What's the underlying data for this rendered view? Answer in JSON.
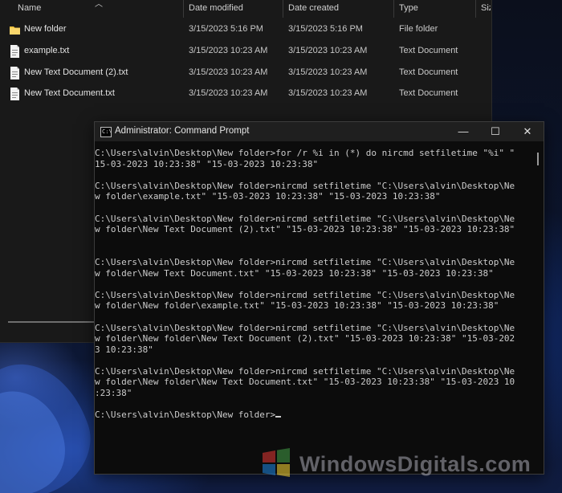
{
  "explorer": {
    "columns": {
      "name": "Name",
      "date_modified": "Date modified",
      "date_created": "Date created",
      "type": "Type",
      "size": "Size"
    },
    "files": [
      {
        "name": "New folder",
        "modified": "3/15/2023 5:16 PM",
        "created": "3/15/2023 5:16 PM",
        "type": "File folder",
        "icon": "folder-icon"
      },
      {
        "name": "example.txt",
        "modified": "3/15/2023 10:23 AM",
        "created": "3/15/2023 10:23 AM",
        "type": "Text Document",
        "icon": "text-file-icon"
      },
      {
        "name": "New Text Document (2).txt",
        "modified": "3/15/2023 10:23 AM",
        "created": "3/15/2023 10:23 AM",
        "type": "Text Document",
        "icon": "text-file-icon"
      },
      {
        "name": "New Text Document.txt",
        "modified": "3/15/2023 10:23 AM",
        "created": "3/15/2023 10:23 AM",
        "type": "Text Document",
        "icon": "text-file-icon"
      }
    ]
  },
  "cmd": {
    "title": "Administrator: Command Prompt",
    "app_icon_text": "C:\\",
    "controls": {
      "minimize": "—",
      "maximize": "☐",
      "close": "✕"
    },
    "lines": [
      "C:\\Users\\alvin\\Desktop\\New folder>for /r %i in (*) do nircmd setfiletime \"%i\" \"",
      "15-03-2023 10:23:38\" \"15-03-2023 10:23:38\"",
      "",
      "C:\\Users\\alvin\\Desktop\\New folder>nircmd setfiletime \"C:\\Users\\alvin\\Desktop\\Ne",
      "w folder\\example.txt\" \"15-03-2023 10:23:38\" \"15-03-2023 10:23:38\"",
      "",
      "C:\\Users\\alvin\\Desktop\\New folder>nircmd setfiletime \"C:\\Users\\alvin\\Desktop\\Ne",
      "w folder\\New Text Document (2).txt\" \"15-03-2023 10:23:38\" \"15-03-2023 10:23:38\"",
      "",
      "",
      "C:\\Users\\alvin\\Desktop\\New folder>nircmd setfiletime \"C:\\Users\\alvin\\Desktop\\Ne",
      "w folder\\New Text Document.txt\" \"15-03-2023 10:23:38\" \"15-03-2023 10:23:38\"",
      "",
      "C:\\Users\\alvin\\Desktop\\New folder>nircmd setfiletime \"C:\\Users\\alvin\\Desktop\\Ne",
      "w folder\\New folder\\example.txt\" \"15-03-2023 10:23:38\" \"15-03-2023 10:23:38\"",
      "",
      "C:\\Users\\alvin\\Desktop\\New folder>nircmd setfiletime \"C:\\Users\\alvin\\Desktop\\Ne",
      "w folder\\New folder\\New Text Document (2).txt\" \"15-03-2023 10:23:38\" \"15-03-202",
      "3 10:23:38\"",
      "",
      "C:\\Users\\alvin\\Desktop\\New folder>nircmd setfiletime \"C:\\Users\\alvin\\Desktop\\Ne",
      "w folder\\New folder\\New Text Document.txt\" \"15-03-2023 10:23:38\" \"15-03-2023 10",
      ":23:38\"",
      ""
    ],
    "prompt": "C:\\Users\\alvin\\Desktop\\New folder>"
  },
  "watermark": {
    "text": "WindowsDigitals.com",
    "colors": [
      "#e53935",
      "#43a047",
      "#1e88e5",
      "#fdd835"
    ]
  }
}
